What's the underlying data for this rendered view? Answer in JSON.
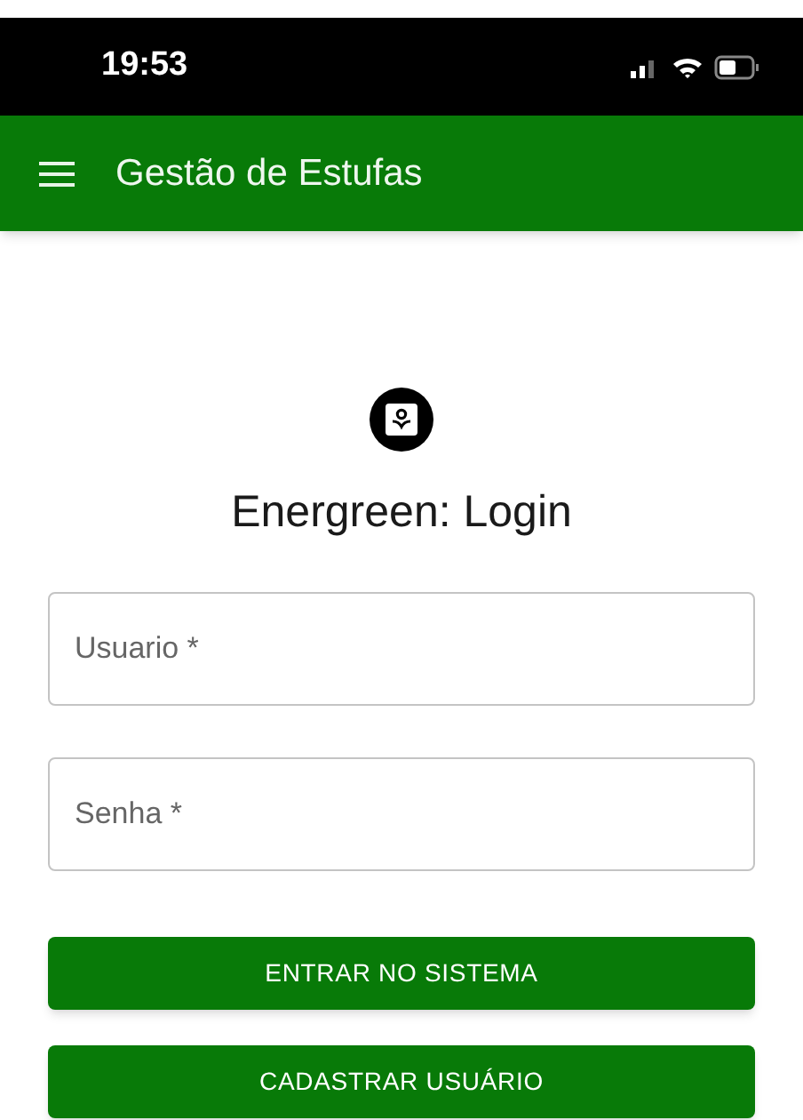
{
  "status_bar": {
    "time": "19:53"
  },
  "app_bar": {
    "title": "Gestão de Estufas"
  },
  "login": {
    "title": "Energreen: Login",
    "fields": [
      {
        "placeholder": "Usuario *"
      },
      {
        "placeholder": "Senha *"
      }
    ],
    "buttons": [
      "ENTRAR NO SISTEMA",
      "CADASTRAR USUÁRIO"
    ]
  }
}
